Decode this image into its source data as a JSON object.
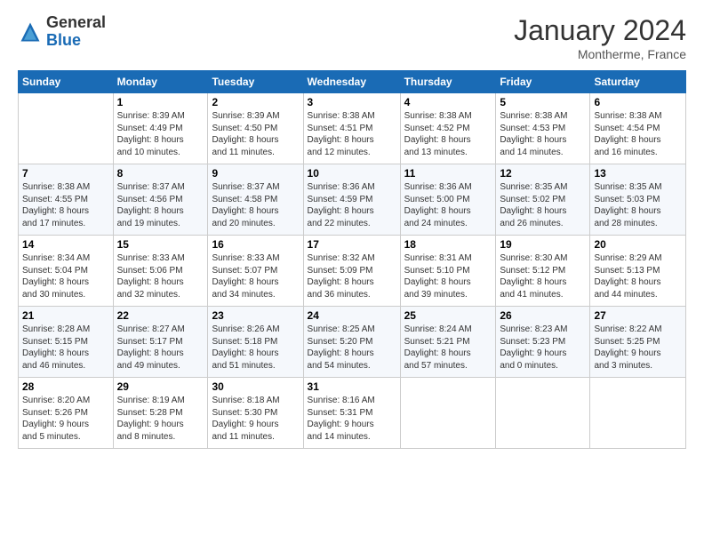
{
  "header": {
    "logo_general": "General",
    "logo_blue": "Blue",
    "month_title": "January 2024",
    "subtitle": "Montherme, France"
  },
  "days_of_week": [
    "Sunday",
    "Monday",
    "Tuesday",
    "Wednesday",
    "Thursday",
    "Friday",
    "Saturday"
  ],
  "weeks": [
    [
      {
        "num": "",
        "info": ""
      },
      {
        "num": "1",
        "info": "Sunrise: 8:39 AM\nSunset: 4:49 PM\nDaylight: 8 hours\nand 10 minutes."
      },
      {
        "num": "2",
        "info": "Sunrise: 8:39 AM\nSunset: 4:50 PM\nDaylight: 8 hours\nand 11 minutes."
      },
      {
        "num": "3",
        "info": "Sunrise: 8:38 AM\nSunset: 4:51 PM\nDaylight: 8 hours\nand 12 minutes."
      },
      {
        "num": "4",
        "info": "Sunrise: 8:38 AM\nSunset: 4:52 PM\nDaylight: 8 hours\nand 13 minutes."
      },
      {
        "num": "5",
        "info": "Sunrise: 8:38 AM\nSunset: 4:53 PM\nDaylight: 8 hours\nand 14 minutes."
      },
      {
        "num": "6",
        "info": "Sunrise: 8:38 AM\nSunset: 4:54 PM\nDaylight: 8 hours\nand 16 minutes."
      }
    ],
    [
      {
        "num": "7",
        "info": "Sunrise: 8:38 AM\nSunset: 4:55 PM\nDaylight: 8 hours\nand 17 minutes."
      },
      {
        "num": "8",
        "info": "Sunrise: 8:37 AM\nSunset: 4:56 PM\nDaylight: 8 hours\nand 19 minutes."
      },
      {
        "num": "9",
        "info": "Sunrise: 8:37 AM\nSunset: 4:58 PM\nDaylight: 8 hours\nand 20 minutes."
      },
      {
        "num": "10",
        "info": "Sunrise: 8:36 AM\nSunset: 4:59 PM\nDaylight: 8 hours\nand 22 minutes."
      },
      {
        "num": "11",
        "info": "Sunrise: 8:36 AM\nSunset: 5:00 PM\nDaylight: 8 hours\nand 24 minutes."
      },
      {
        "num": "12",
        "info": "Sunrise: 8:35 AM\nSunset: 5:02 PM\nDaylight: 8 hours\nand 26 minutes."
      },
      {
        "num": "13",
        "info": "Sunrise: 8:35 AM\nSunset: 5:03 PM\nDaylight: 8 hours\nand 28 minutes."
      }
    ],
    [
      {
        "num": "14",
        "info": "Sunrise: 8:34 AM\nSunset: 5:04 PM\nDaylight: 8 hours\nand 30 minutes."
      },
      {
        "num": "15",
        "info": "Sunrise: 8:33 AM\nSunset: 5:06 PM\nDaylight: 8 hours\nand 32 minutes."
      },
      {
        "num": "16",
        "info": "Sunrise: 8:33 AM\nSunset: 5:07 PM\nDaylight: 8 hours\nand 34 minutes."
      },
      {
        "num": "17",
        "info": "Sunrise: 8:32 AM\nSunset: 5:09 PM\nDaylight: 8 hours\nand 36 minutes."
      },
      {
        "num": "18",
        "info": "Sunrise: 8:31 AM\nSunset: 5:10 PM\nDaylight: 8 hours\nand 39 minutes."
      },
      {
        "num": "19",
        "info": "Sunrise: 8:30 AM\nSunset: 5:12 PM\nDaylight: 8 hours\nand 41 minutes."
      },
      {
        "num": "20",
        "info": "Sunrise: 8:29 AM\nSunset: 5:13 PM\nDaylight: 8 hours\nand 44 minutes."
      }
    ],
    [
      {
        "num": "21",
        "info": "Sunrise: 8:28 AM\nSunset: 5:15 PM\nDaylight: 8 hours\nand 46 minutes."
      },
      {
        "num": "22",
        "info": "Sunrise: 8:27 AM\nSunset: 5:17 PM\nDaylight: 8 hours\nand 49 minutes."
      },
      {
        "num": "23",
        "info": "Sunrise: 8:26 AM\nSunset: 5:18 PM\nDaylight: 8 hours\nand 51 minutes."
      },
      {
        "num": "24",
        "info": "Sunrise: 8:25 AM\nSunset: 5:20 PM\nDaylight: 8 hours\nand 54 minutes."
      },
      {
        "num": "25",
        "info": "Sunrise: 8:24 AM\nSunset: 5:21 PM\nDaylight: 8 hours\nand 57 minutes."
      },
      {
        "num": "26",
        "info": "Sunrise: 8:23 AM\nSunset: 5:23 PM\nDaylight: 9 hours\nand 0 minutes."
      },
      {
        "num": "27",
        "info": "Sunrise: 8:22 AM\nSunset: 5:25 PM\nDaylight: 9 hours\nand 3 minutes."
      }
    ],
    [
      {
        "num": "28",
        "info": "Sunrise: 8:20 AM\nSunset: 5:26 PM\nDaylight: 9 hours\nand 5 minutes."
      },
      {
        "num": "29",
        "info": "Sunrise: 8:19 AM\nSunset: 5:28 PM\nDaylight: 9 hours\nand 8 minutes."
      },
      {
        "num": "30",
        "info": "Sunrise: 8:18 AM\nSunset: 5:30 PM\nDaylight: 9 hours\nand 11 minutes."
      },
      {
        "num": "31",
        "info": "Sunrise: 8:16 AM\nSunset: 5:31 PM\nDaylight: 9 hours\nand 14 minutes."
      },
      {
        "num": "",
        "info": ""
      },
      {
        "num": "",
        "info": ""
      },
      {
        "num": "",
        "info": ""
      }
    ]
  ]
}
